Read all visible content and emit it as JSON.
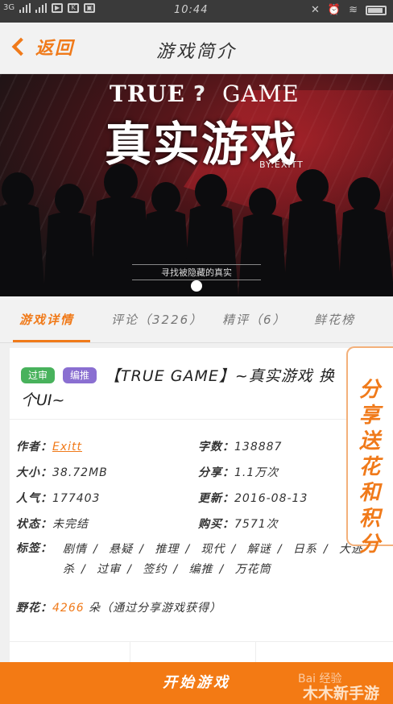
{
  "statusbar": {
    "network": "3G",
    "time": "10:44"
  },
  "nav": {
    "back_label": "返回",
    "title": "游戏简介"
  },
  "banner": {
    "title_left": "TRUE",
    "title_mark": "?",
    "title_right": "GAME",
    "title_cn": "真实游戏",
    "byline": "BY:EXITT",
    "subtitle": "寻找被隐藏的真实"
  },
  "tabs": [
    {
      "label": "游戏详情",
      "active": true
    },
    {
      "label": "评论（3226）",
      "active": false
    },
    {
      "label": "精评（6）",
      "active": false
    },
    {
      "label": "鲜花榜",
      "active": false
    }
  ],
  "game": {
    "badge_audit": "过审",
    "badge_recommend": "编推",
    "title_line1": "【TRUE GAME】~真实游戏 换",
    "title_line2": "个UI~",
    "author_label": "作者：",
    "author": "Exitt",
    "words_label": "字数：",
    "words": "138887",
    "size_label": "大小：",
    "size": "38.72MB",
    "shares_label": "分享：",
    "shares": "1.1万次",
    "popularity_label": "人气：",
    "popularity": "177403",
    "updated_label": "更新：",
    "updated": "2016-08-13",
    "status_label": "状态：",
    "status": "未完结",
    "purchases_label": "购买：",
    "purchases": "7571次",
    "tags_label": "标签：",
    "tags": [
      "剧情",
      "/",
      "悬疑",
      "/",
      "推理",
      "/",
      "现代",
      "/",
      "解谜",
      "/",
      "日系",
      "/",
      "大逃杀",
      "/",
      "过审",
      "/",
      "签约",
      "/",
      "编推",
      "/",
      "万花筒"
    ],
    "flowers_label": "野花：",
    "flowers": "4266",
    "flowers_suffix": "朵（通过分享游戏获得）"
  },
  "share_box": {
    "text": "分享送花和积分"
  },
  "bottom": {
    "start_label": "开始游戏"
  },
  "watermark": {
    "line1": "Bai 经验",
    "line2": "木木新手游"
  },
  "colors": {
    "accent": "#f07a1a",
    "badge_green": "#48b25c",
    "badge_purple": "#8a6fd1"
  }
}
